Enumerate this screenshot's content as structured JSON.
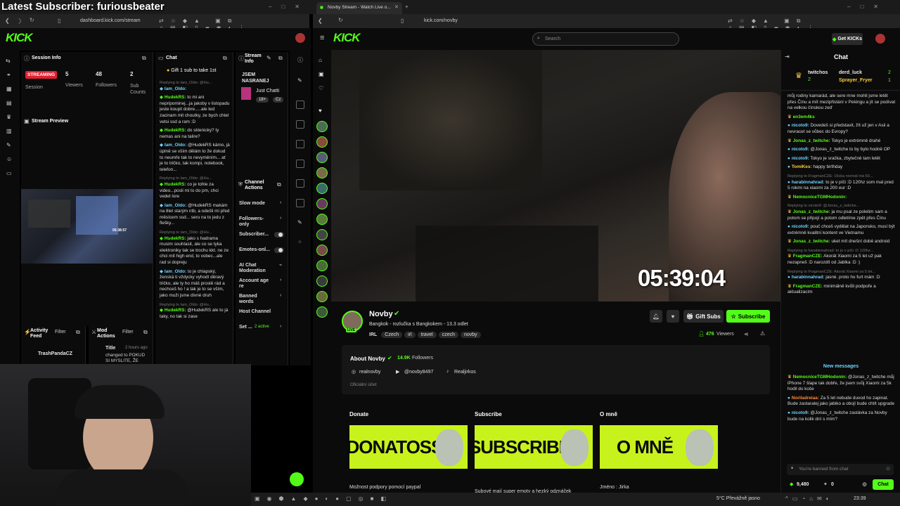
{
  "overlay": {
    "latest_subscriber": "Latest Subscriber: furiousbeater"
  },
  "left_browser": {
    "url": "dashboard.kick.com/stream",
    "session": {
      "title": "Session Info",
      "status": "STREAMING",
      "session_label": "Session",
      "viewers": "5",
      "viewers_label": "Viewers",
      "followers": "48",
      "followers_label": "Followers",
      "subs": "2",
      "subs_label": "Sub Counts"
    },
    "preview_title": "Stream Preview",
    "chat": {
      "title": "Chat",
      "pinned": "Gift 1 sub to take 1st",
      "lines": [
        {
          "user": "Iam_Oldo:",
          "text": "",
          "type": "b",
          "reply": "Replying to Iam_Oldo: @Hu..."
        },
        {
          "user": "HudekRS:",
          "text": "to mi ani nepripominej...ja jakoby v listopadu jeste koupil dobre.....ale ted zacinam mit choutky, ze bych chtel vetsi ssd a ram :D",
          "type": "g",
          "reply": ""
        },
        {
          "user": "HudekRS:",
          "text": "do sklenicky? ty nemas ani na talire?",
          "type": "g",
          "reply": ""
        },
        {
          "user": "Iam_Oldo:",
          "text": "@HudekRS kámo, já úplně se vším dělám to že dokud to neumře tak to nevyměním... ať je to tričko, tak kompi, notebook, telefon...",
          "type": "b",
          "reply": ""
        },
        {
          "user": "HudekRS:",
          "text": "co je tohle za video...posli mi to do pm, chci vedet lore",
          "type": "g",
          "reply": "Replying to Iam_Oldo: @Hu..."
        },
        {
          "user": "Iam_Oldo:",
          "text": "@HudekRS makám na 8let starým ntb, a odešli mi před měsícem ssd... seru na to jedu z flešky...",
          "type": "b",
          "reply": ""
        },
        {
          "user": "HudekRS:",
          "text": "jako s hadrama musim souhlasit, ale co se tyka elektroniky tak se trochu kkt. ne ze chci mit high end, to vubec...ale rad si dopreju",
          "type": "g",
          "reply": "Replying to Iam_Oldo: @Hu..."
        },
        {
          "user": "Iam_Oldo:",
          "text": "to je chlapský, ženská ti vždycky vyhodí děravý tričko, ale ty ho máš prostě rád a nechceš ho ! a tak je to se vším, jako muži jsme divné druh",
          "type": "b",
          "reply": ""
        },
        {
          "user": "HudekRS:",
          "text": "@HudekRS ale to já taky, no tak si zase",
          "type": "g",
          "reply": "Replying to Iam_Oldo: @Hu..."
        }
      ]
    },
    "stream_info": {
      "title": "Stream Info",
      "stream_title": "JSEM NASRANEJ",
      "category": "Just Chatti",
      "rating": "18+",
      "lang": "Cz"
    },
    "channel_actions": {
      "title": "Channel Actions",
      "items": [
        {
          "label": "Slow mode",
          "control": "arrow"
        },
        {
          "label": "Followers-only",
          "control": "arrow"
        },
        {
          "label": "Subscriber...",
          "control": "toggle"
        },
        {
          "label": "Emotes-onl...",
          "control": "toggle"
        },
        {
          "label": "AI Chat Moderation",
          "control": "icon"
        },
        {
          "label": "Account age re",
          "control": "arrow"
        },
        {
          "label": "Banned words",
          "control": "arrow"
        },
        {
          "label": "Host Channel",
          "control": ""
        },
        {
          "label": "Set ...",
          "control": "active",
          "extra": "2 active"
        }
      ]
    },
    "activity": {
      "title": "Activity Feed",
      "filter": "Filter",
      "item": "TrashPandaCZ"
    },
    "mod_actions": {
      "title": "Mod Actions",
      "filter": "Filter",
      "col": "Title",
      "time": "2 hours ago",
      "text": "changed to POKUD SI MYSLITE, ŽE"
    }
  },
  "tabs": {
    "left_tab": "Novby Stream - Watch Live o..."
  },
  "right_browser": {
    "url": "kick.com/novby",
    "search_placeholder": "Search",
    "get_kicks": "Get KICKs",
    "timer": "05:39:04",
    "channel": {
      "name": "Novby",
      "title": "Bangkok - rozlučka s Bangkokem - 13.3 odlet",
      "tags": [
        "IRL",
        "Czech",
        "irl",
        "travel",
        "czech",
        "novby"
      ],
      "gift_subs": "Gift Subs",
      "subscribe": "Subscribe",
      "viewers": "476",
      "viewers_label": "Viewers"
    },
    "about": {
      "title": "About Novby",
      "followers": "14.9K",
      "followers_label": "Followers",
      "links": [
        "realnovby",
        "@novby8497",
        "Realjirkos"
      ],
      "official": "Oficiální účet"
    },
    "panels": [
      {
        "heading": "Donate",
        "banner": "DONATOSS",
        "caption": "Možnost podpory pomocí paypal"
      },
      {
        "heading": "Subscribe",
        "banner": "SUBSCRIBE",
        "caption": "Subové mají super emoty a hezký odznáček"
      },
      {
        "heading": "O mně",
        "banner": "O MNĚ",
        "caption": "Jméno : Jirka"
      }
    ],
    "chat": {
      "title": "Chat",
      "leaders": [
        {
          "name": "twitchos",
          "count": "2"
        },
        {
          "name": "derd_luck",
          "count": "2"
        },
        {
          "name": "Sprayer_Fryer",
          "count": "1"
        }
      ],
      "lines": [
        {
          "user": "",
          "text": "můj rodiny kamarád, ale sere mne mohli jsme letět přes Čínu a mít mezipřistání v Pekingu a jít se podívat na velkou čínskou zeď",
          "type": "",
          "reply": ""
        },
        {
          "user": "en3em4ks",
          "text": "",
          "type": "g",
          "reply": ""
        },
        {
          "user": "nicoto9:",
          "text": "Dovedeš si představit, žít už jen v Asii a nevracet se vůbec do Evropy?",
          "type": "b",
          "reply": ""
        },
        {
          "user": "Jonas_z_twitche:",
          "text": "Tokyo je extrémně drahé",
          "type": "g",
          "reply": ""
        },
        {
          "user": "nicoto9:",
          "text": "@Jonas_z_twitche to by bylo hodně OP",
          "type": "b",
          "reply": ""
        },
        {
          "user": "nicoto9:",
          "text": "Tokyo je sračka, zbytečně tam letět",
          "type": "b",
          "reply": ""
        },
        {
          "user": "TomiKes:",
          "text": "happy birthday",
          "type": "y",
          "reply": ""
        },
        {
          "user": "harabinnahrad:",
          "text": "to je v píči :D 120hz som mal pred 5 rokmi na xiaomi za 200 eur :D",
          "type": "b",
          "reply": "Replying to FragmanCZE: 16cka normál má 60..."
        },
        {
          "user": "NemocniceTGMHodonin:",
          "text": "",
          "type": "g",
          "reply": ""
        },
        {
          "user": "Jonas_z_twitche:",
          "text": "ja mu psal ze poletim sam a potom se připojí a potom odletíme zpět přes Čínu",
          "type": "g",
          "reply": "Replying to nicoto9: @Jonas_z_twitche..."
        },
        {
          "user": "nicoto9:",
          "text": "pouč chceš vydělat na Japonsko, musí být extrémně kvalitní kontent ve Vietnamu",
          "type": "b",
          "reply": ""
        },
        {
          "user": "Jonas_z_twitche:",
          "text": "uket mít dnešní době android",
          "type": "g",
          "reply": ""
        },
        {
          "user": "FragmanCZE:",
          "text": "Akorát Xiaomi za 5 let už pak nezapneš :D narozdíl od Jablka :D :)",
          "type": "g",
          "reply": "Replying to harabinnahrad: to je v píči :D 120hz..."
        },
        {
          "user": "harabinnahrad:",
          "text": "jasné. proto ho furt mám :D",
          "type": "b",
          "reply": "Replying to FragmanCZE: Akorát Xiaomi za 5 let..."
        },
        {
          "user": "FragmanCZE:",
          "text": "minimálně kvůli podpoře a aktualizacím",
          "type": "g",
          "reply": ""
        }
      ],
      "new_messages": "New messages",
      "lines2": [
        {
          "user": "NemocniceTGMHodonin:",
          "text": "@Jonas_z_twitche můj iPhone 7 šlape tak dobře, že jsem svůj Xiaomi za 5k hodil do koše",
          "type": "g"
        },
        {
          "user": "Noriladreiaa:",
          "text": "Za 5 let nebude duvod ho zapinat. Bude zastaralej jako jabiko a obojí bude chtít upgrade",
          "type": "o"
        },
        {
          "user": "nicoto9:",
          "text": "@Jonas_z_twitche zastávka za Novby bude na kolik dní s mím?",
          "type": "b"
        }
      ],
      "banned_placeholder": "You're banned from chat",
      "kicks": "9,480",
      "zero": "0",
      "chat_button": "Chat"
    }
  },
  "taskbar": {
    "weather": "5°C  Převážně jasno",
    "time": "23:39"
  },
  "colors": {
    "accent": "#53fc18",
    "streaming": "#e0202f"
  }
}
